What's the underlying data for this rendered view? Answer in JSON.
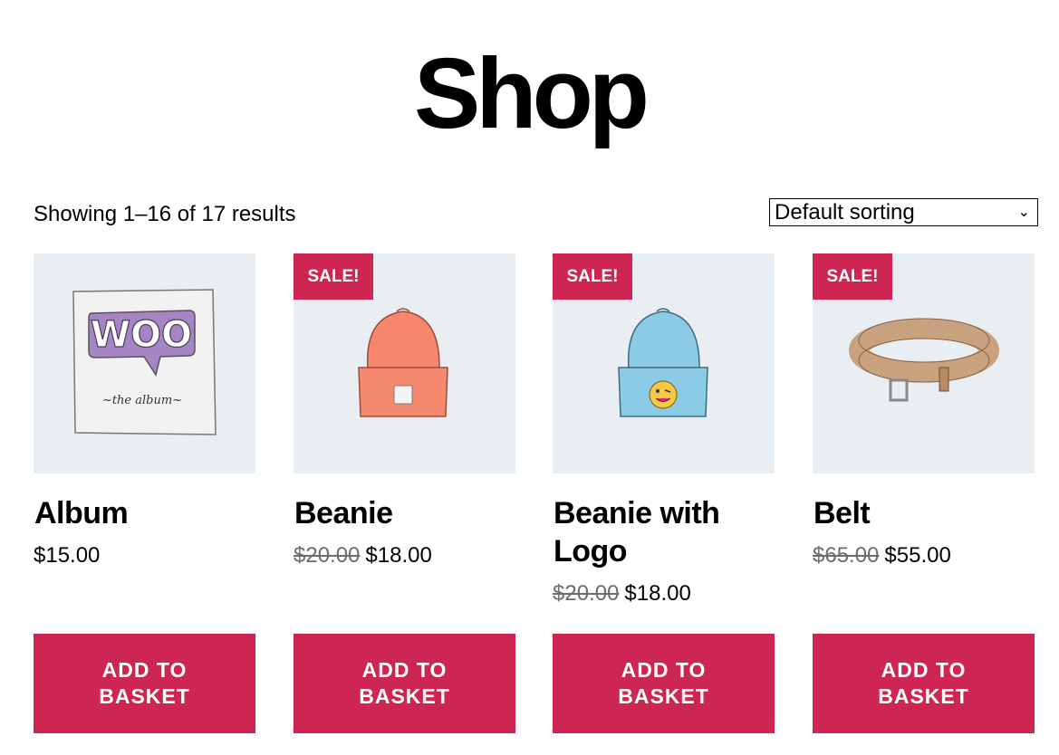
{
  "page": {
    "title": "Shop"
  },
  "toolbar": {
    "result_count": "Showing 1–16 of 17 results",
    "sort_selected": "Default sorting",
    "sort_chevron": "⌄"
  },
  "colors": {
    "accent": "#cd2653",
    "thumb_bg": "#e9eef2",
    "old_price": "#6d6d6d"
  },
  "products": [
    {
      "name": "Album",
      "price": "$15.00",
      "old_price": "",
      "sale_label": "",
      "button_label": "ADD TO BASKET",
      "image_icon": "album-icon"
    },
    {
      "name": "Beanie",
      "price": "$18.00",
      "old_price": "$20.00",
      "sale_label": "SALE!",
      "button_label": "ADD TO BASKET",
      "image_icon": "beanie-icon"
    },
    {
      "name": "Beanie with Logo",
      "price": "$18.00",
      "old_price": "$20.00",
      "sale_label": "SALE!",
      "button_label": "ADD TO BASKET",
      "image_icon": "beanie-logo-icon"
    },
    {
      "name": "Belt",
      "price": "$55.00",
      "old_price": "$65.00",
      "sale_label": "SALE!",
      "button_label": "ADD TO BASKET",
      "image_icon": "belt-icon"
    }
  ]
}
